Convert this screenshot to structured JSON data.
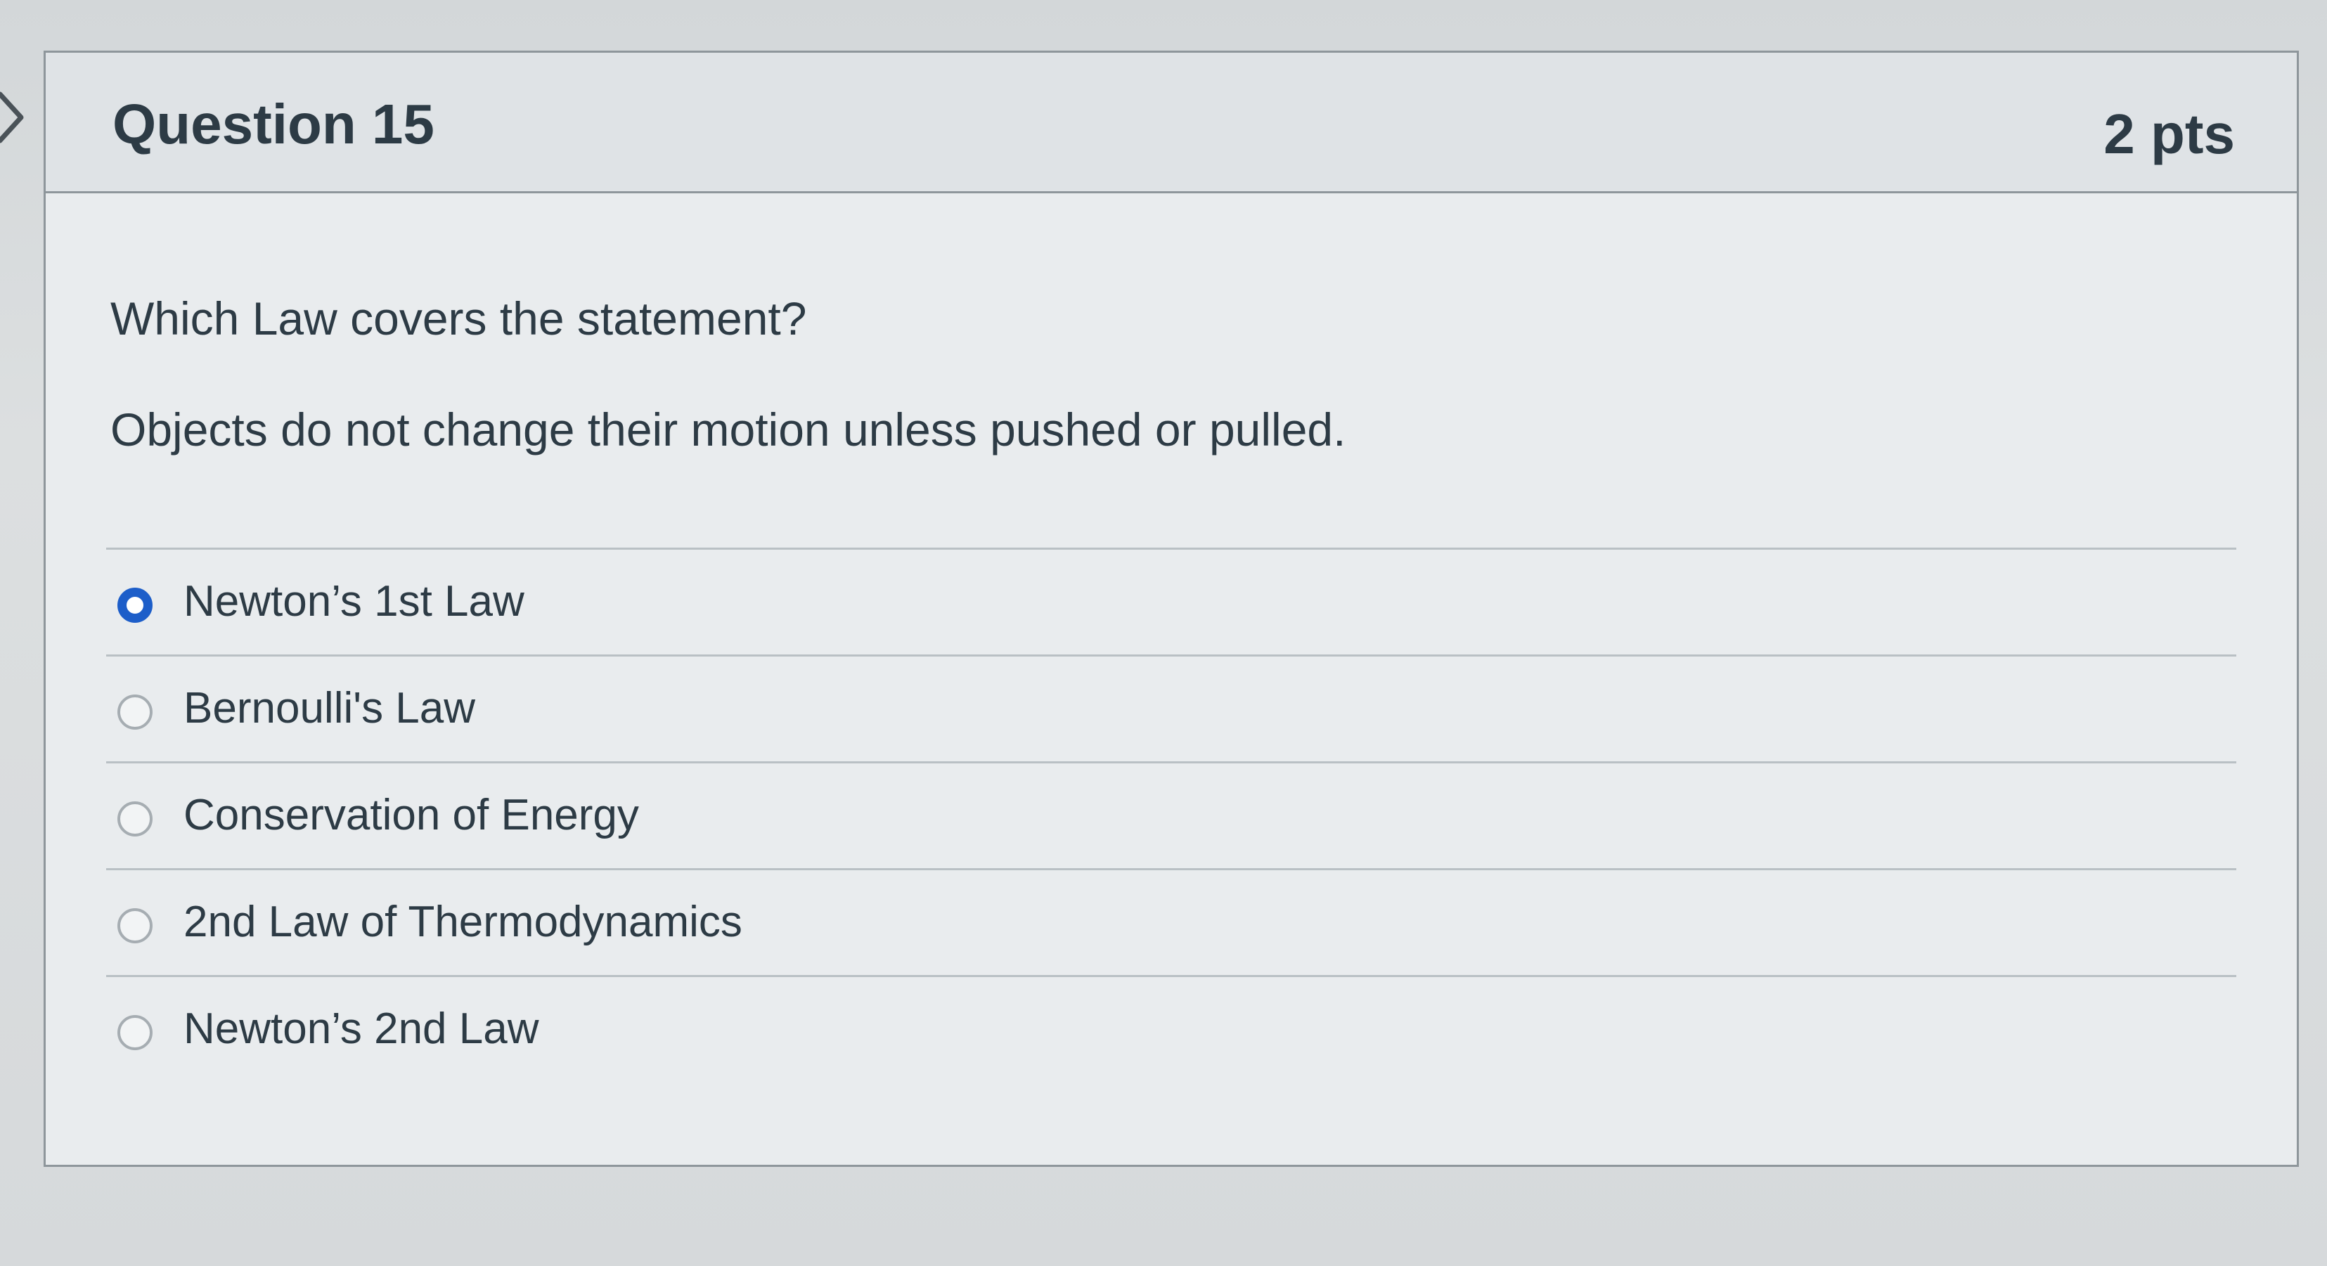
{
  "question": {
    "title": "Question 15",
    "points": "2 pts",
    "prompt": "Which Law covers the statement?",
    "statement": "Objects do not change their motion unless pushed or pulled.",
    "answers": [
      {
        "label": "Newton’s 1st Law",
        "selected": true
      },
      {
        "label": "Bernoulli's Law",
        "selected": false
      },
      {
        "label": "Conservation of Energy",
        "selected": false
      },
      {
        "label": "2nd Law of Thermodynamics",
        "selected": false
      },
      {
        "label": "Newton’s 2nd Law",
        "selected": false
      }
    ]
  },
  "icons": {
    "nav": "chevron-right-icon"
  },
  "colors": {
    "selected_radio": "#1d5ec9",
    "text": "#2d3b45",
    "border": "#8e969b"
  }
}
